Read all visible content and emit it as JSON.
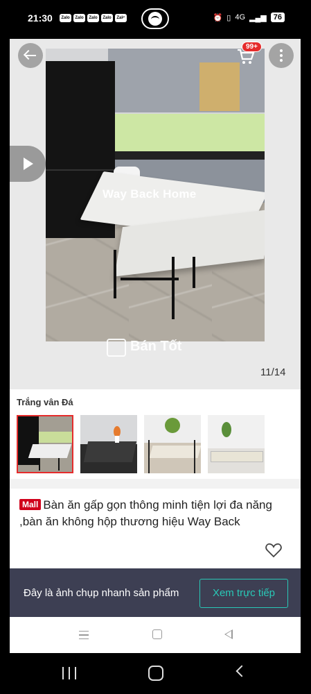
{
  "status_bar": {
    "time": "21:30",
    "notification_icons": [
      "Zalo",
      "Zalo",
      "Zalo",
      "Zalo",
      "Zalo"
    ],
    "dot": "•",
    "network": "4G",
    "battery": "76"
  },
  "gallery": {
    "watermark_text": "Way Back Home",
    "brand_watermark": "Bán Tốt",
    "counter": "11/14",
    "cart_badge": "99+",
    "icons": [
      "back-arrow-icon",
      "cart-icon",
      "more-vertical-icon",
      "play-icon"
    ]
  },
  "variant": {
    "name": "Trắng vân Đá",
    "thumbnail_count": 4,
    "selected_index": 0
  },
  "product": {
    "mall_badge": "Mall",
    "title": "Bàn ăn gấp gọn thông minh tiện lợi đa năng ,bàn ăn không hộp  thương hiệu Way Back"
  },
  "snapshot": {
    "text": "Đây là ảnh chụp nhanh sản phẩm",
    "button_label": "Xem trực tiếp"
  },
  "colors": {
    "accent_red": "#e52b2b",
    "mall_red": "#d0011b",
    "teal": "#29c9b7",
    "snapshot_bg": "#3d3f53"
  }
}
